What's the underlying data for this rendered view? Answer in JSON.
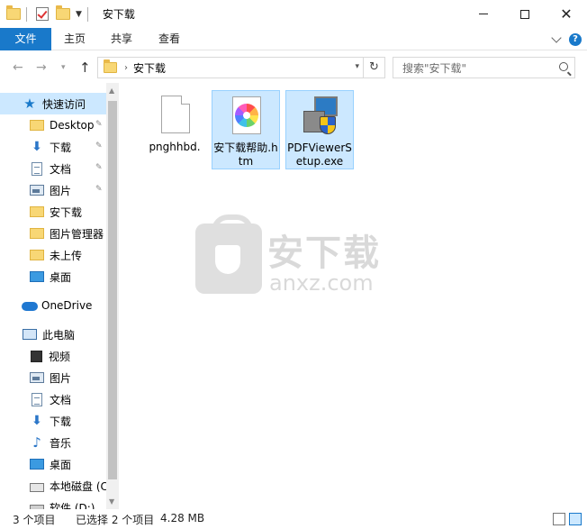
{
  "window": {
    "title": "安下载"
  },
  "ribbon": {
    "tabs": [
      "文件",
      "主页",
      "共享",
      "查看"
    ]
  },
  "address": {
    "crumb": "安下载",
    "search_placeholder": "搜索\"安下载\""
  },
  "nav": {
    "quick_access": "快速访问",
    "quick_items": [
      {
        "label": "Desktop",
        "icon": "folder-icon",
        "pinned": true
      },
      {
        "label": "下载",
        "icon": "download-icon",
        "pinned": true
      },
      {
        "label": "文档",
        "icon": "document-icon",
        "pinned": true
      },
      {
        "label": "图片",
        "icon": "picture-icon",
        "pinned": true
      },
      {
        "label": "安下载",
        "icon": "folder-icon",
        "pinned": false
      },
      {
        "label": "图片管理器",
        "icon": "folder-icon",
        "pinned": false
      },
      {
        "label": "未上传",
        "icon": "folder-icon",
        "pinned": false
      },
      {
        "label": "桌面",
        "icon": "desktop-icon",
        "pinned": false
      }
    ],
    "onedrive": "OneDrive",
    "this_pc": "此电脑",
    "pc_items": [
      {
        "label": "视频",
        "icon": "video-icon"
      },
      {
        "label": "图片",
        "icon": "picture-icon"
      },
      {
        "label": "文档",
        "icon": "document-icon"
      },
      {
        "label": "下载",
        "icon": "download-icon"
      },
      {
        "label": "音乐",
        "icon": "music-icon"
      },
      {
        "label": "桌面",
        "icon": "desktop-icon"
      },
      {
        "label": "本地磁盘 (C",
        "icon": "drive-icon"
      },
      {
        "label": "软件 (D:)",
        "icon": "drive-icon"
      }
    ]
  },
  "files": [
    {
      "name": "pnghhbd.",
      "icon": "blank-file-icon",
      "selected": false
    },
    {
      "name": "安下载帮助.htm",
      "icon": "htm-file-icon",
      "selected": true
    },
    {
      "name": "PDFViewerSetup.exe",
      "icon": "installer-icon",
      "selected": true
    }
  ],
  "watermark": {
    "cn": "安下载",
    "en": "anxz.com"
  },
  "status": {
    "count": "3 个项目",
    "selected": "已选择 2 个项目",
    "size": "4.28 MB"
  },
  "colors": {
    "accent": "#1979ca",
    "selection": "#cce8ff"
  }
}
